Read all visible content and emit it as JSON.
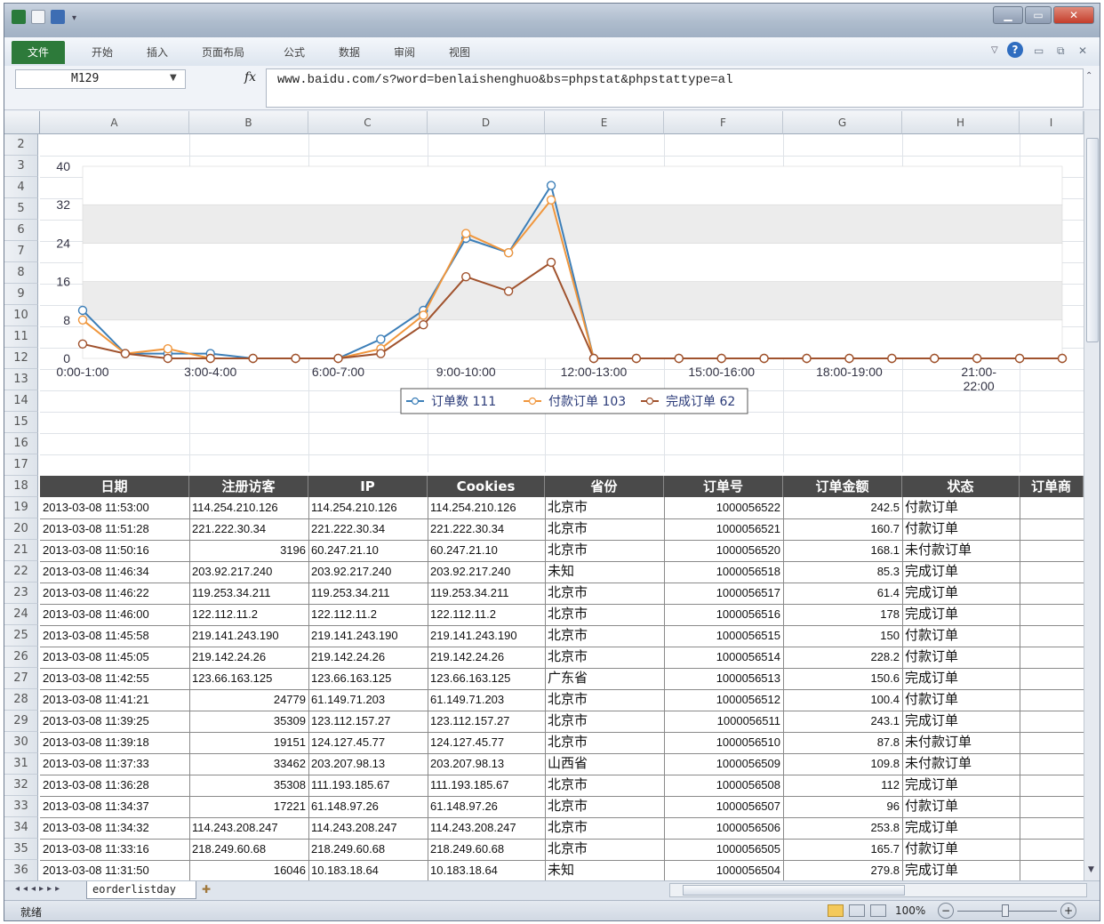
{
  "titlebar": {
    "app_icon": "excel-icon",
    "quick_access": [
      "save-icon",
      "undo-icon",
      "customize-icon"
    ],
    "controls": [
      "minimize-icon",
      "maximize-icon",
      "close-icon"
    ]
  },
  "ribbon": {
    "file_tab": "文件",
    "tabs": [
      "开始",
      "插入",
      "页面布局",
      "公式",
      "数据",
      "审阅",
      "视图"
    ],
    "right_icons": [
      "ribbon-collapse-icon",
      "help-icon",
      "window-minimize-icon",
      "window-restore-icon",
      "window-close-icon"
    ]
  },
  "formula_bar": {
    "name_box": "M129",
    "fx_label": "fx",
    "formula": "www.baidu.com/s?word=benlaishenghuo&bs=phpstat&phpstattype=al"
  },
  "columns": [
    "A",
    "B",
    "C",
    "D",
    "E",
    "F",
    "G",
    "H",
    "I"
  ],
  "rows": [
    "2",
    "3",
    "4",
    "5",
    "6",
    "7",
    "8",
    "9",
    "10",
    "11",
    "12",
    "13",
    "14",
    "15",
    "16",
    "17",
    "18",
    "19",
    "20",
    "21",
    "22",
    "23",
    "24",
    "25",
    "26",
    "27",
    "28",
    "29",
    "30",
    "31",
    "32",
    "33",
    "34",
    "35",
    "36"
  ],
  "chart_data": {
    "type": "line",
    "x": [
      "0:00-1:00",
      "1:00-2:00",
      "2:00-3:00",
      "3:00-4:00",
      "4:00-5:00",
      "5:00-6:00",
      "6:00-7:00",
      "7:00-8:00",
      "8:00-9:00",
      "9:00-10:00",
      "10:00-11:00",
      "11:00-12:00",
      "12:00-13:00",
      "13:00-14:00",
      "14:00-15:00",
      "15:00-16:00",
      "16:00-17:00",
      "17:00-18:00",
      "18:00-19:00",
      "19:00-20:00",
      "20:00-21:00",
      "21:00-22:00",
      "22:00-23:00",
      "23:00-24:00"
    ],
    "x_tick_labels": [
      "0:00-1:00",
      "3:00-4:00",
      "6:00-7:00",
      "9:00-10:00",
      "12:00-13:00",
      "15:00-16:00",
      "18:00-19:00",
      "21:00-22:00"
    ],
    "y_ticks": [
      "0",
      "8",
      "16",
      "24",
      "32",
      "40"
    ],
    "ylim": [
      0,
      40
    ],
    "series": [
      {
        "name": "订单数 111",
        "color": "#3d7fb8",
        "values": [
          10,
          1,
          1,
          1,
          0,
          0,
          0,
          4,
          10,
          25,
          22,
          36,
          0,
          0,
          0,
          0,
          0,
          0,
          0,
          0,
          0,
          0,
          0,
          0
        ]
      },
      {
        "name": "付款订单 103",
        "color": "#f0963c",
        "values": [
          8,
          1,
          2,
          0,
          0,
          0,
          0,
          2,
          9,
          26,
          22,
          33,
          0,
          0,
          0,
          0,
          0,
          0,
          0,
          0,
          0,
          0,
          0,
          0
        ]
      },
      {
        "name": "完成订单 62",
        "color": "#a0522d",
        "values": [
          3,
          1,
          0,
          0,
          0,
          0,
          0,
          1,
          7,
          17,
          14,
          20,
          0,
          0,
          0,
          0,
          0,
          0,
          0,
          0,
          0,
          0,
          0,
          0
        ]
      }
    ],
    "legend_position": "bottom",
    "grid": "horizontal bands"
  },
  "table": {
    "headers": [
      "日期",
      "注册访客",
      "IP",
      "Cookies",
      "省份",
      "订单号",
      "订单金额",
      "状态",
      "订单商"
    ],
    "rows": [
      [
        "2013-03-08 11:53:00",
        "114.254.210.126",
        "114.254.210.126",
        "114.254.210.126",
        "北京市",
        "1000056522",
        "242.5",
        "付款订单"
      ],
      [
        "2013-03-08 11:51:28",
        "221.222.30.34",
        "221.222.30.34",
        "221.222.30.34",
        "北京市",
        "1000056521",
        "160.7",
        "付款订单"
      ],
      [
        "2013-03-08 11:50:16",
        "3196",
        "60.247.21.10",
        "60.247.21.10",
        "北京市",
        "1000056520",
        "168.1",
        "未付款订单"
      ],
      [
        "2013-03-08 11:46:34",
        "203.92.217.240",
        "203.92.217.240",
        "203.92.217.240",
        "未知",
        "1000056518",
        "85.3",
        "完成订单"
      ],
      [
        "2013-03-08 11:46:22",
        "119.253.34.211",
        "119.253.34.211",
        "119.253.34.211",
        "北京市",
        "1000056517",
        "61.4",
        "完成订单"
      ],
      [
        "2013-03-08 11:46:00",
        "122.112.11.2",
        "122.112.11.2",
        "122.112.11.2",
        "北京市",
        "1000056516",
        "178",
        "完成订单"
      ],
      [
        "2013-03-08 11:45:58",
        "219.141.243.190",
        "219.141.243.190",
        "219.141.243.190",
        "北京市",
        "1000056515",
        "150",
        "付款订单"
      ],
      [
        "2013-03-08 11:45:05",
        "219.142.24.26",
        "219.142.24.26",
        "219.142.24.26",
        "北京市",
        "1000056514",
        "228.2",
        "付款订单"
      ],
      [
        "2013-03-08 11:42:55",
        "123.66.163.125",
        "123.66.163.125",
        "123.66.163.125",
        "广东省",
        "1000056513",
        "150.6",
        "完成订单"
      ],
      [
        "2013-03-08 11:41:21",
        "24779",
        "61.149.71.203",
        "61.149.71.203",
        "北京市",
        "1000056512",
        "100.4",
        "付款订单"
      ],
      [
        "2013-03-08 11:39:25",
        "35309",
        "123.112.157.27",
        "123.112.157.27",
        "北京市",
        "1000056511",
        "243.1",
        "完成订单"
      ],
      [
        "2013-03-08 11:39:18",
        "19151",
        "124.127.45.77",
        "124.127.45.77",
        "北京市",
        "1000056510",
        "87.8",
        "未付款订单"
      ],
      [
        "2013-03-08 11:37:33",
        "33462",
        "203.207.98.13",
        "203.207.98.13",
        "山西省",
        "1000056509",
        "109.8",
        "未付款订单"
      ],
      [
        "2013-03-08 11:36:28",
        "35308",
        "111.193.185.67",
        "111.193.185.67",
        "北京市",
        "1000056508",
        "112",
        "完成订单"
      ],
      [
        "2013-03-08 11:34:37",
        "17221",
        "61.148.97.26",
        "61.148.97.26",
        "北京市",
        "1000056507",
        "96",
        "付款订单"
      ],
      [
        "2013-03-08 11:34:32",
        "114.243.208.247",
        "114.243.208.247",
        "114.243.208.247",
        "北京市",
        "1000056506",
        "253.8",
        "完成订单"
      ],
      [
        "2013-03-08 11:33:16",
        "218.249.60.68",
        "218.249.60.68",
        "218.249.60.68",
        "北京市",
        "1000056505",
        "165.7",
        "付款订单"
      ],
      [
        "2013-03-08 11:31:50",
        "16046",
        "10.183.18.64",
        "10.183.18.64",
        "未知",
        "1000056504",
        "279.8",
        "完成订单"
      ]
    ]
  },
  "sheet_tabs": {
    "nav_icons": [
      "first-sheet-icon",
      "prev-sheet-icon",
      "next-sheet-icon",
      "last-sheet-icon"
    ],
    "active": "eorderlistday",
    "new_sheet_icon": "new-sheet-icon"
  },
  "statusbar": {
    "ready": "就绪",
    "zoom": "100%",
    "zoom_out": "−",
    "zoom_in": "+"
  }
}
